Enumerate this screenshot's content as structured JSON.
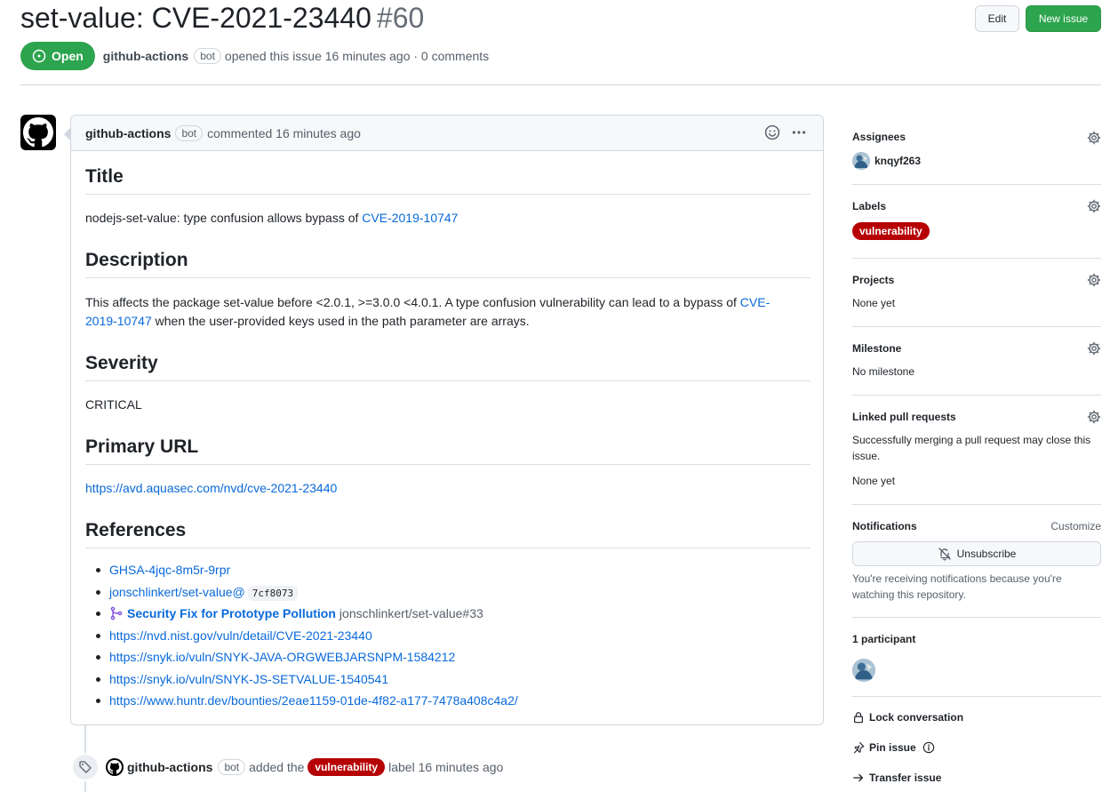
{
  "header": {
    "title": "set-value: CVE-2021-23440",
    "number": "#60",
    "edit_label": "Edit",
    "new_issue_label": "New issue",
    "state": "Open",
    "author": "github-actions",
    "bot": "bot",
    "opened_text": "opened this issue 16 minutes ago · 0 comments"
  },
  "comment": {
    "author": "github-actions",
    "bot": "bot",
    "when": "commented 16 minutes ago",
    "sections": {
      "title_heading": "Title",
      "title_text": "nodejs-set-value: type confusion allows bypass of ",
      "title_link": "CVE-2019-10747",
      "description_heading": "Description",
      "description_text": "This affects the package set-value before <2.0.1, >=3.0.0 <4.0.1. A type confusion vulnerability can lead to a bypass of ",
      "description_link_1": "CVE-",
      "description_link_2": "2019-10747",
      "description_text_2": " when the user-provided keys used in the path parameter are arrays.",
      "severity_heading": "Severity",
      "severity_text": "CRITICAL",
      "primary_url_heading": "Primary URL",
      "primary_url": "https://avd.aquasec.com/nvd/cve-2021-23440",
      "references_heading": "References"
    },
    "references": {
      "ref1": "GHSA-4jqc-8m5r-9rpr",
      "ref2": "jonschlinkert/set-value@",
      "ref2_commit": "7cf8073",
      "ref3_title": "Security Fix for Prototype Pollution",
      "ref3_repo": "jonschlinkert/set-value#33",
      "ref4": "https://nvd.nist.gov/vuln/detail/CVE-2021-23440",
      "ref5": "https://snyk.io/vuln/SNYK-JAVA-ORGWEBJARSNPM-1584212",
      "ref6": "https://snyk.io/vuln/SNYK-JS-SETVALUE-1540541",
      "ref7": "https://www.huntr.dev/bounties/2eae1159-01de-4f82-a177-7478a408c4a2/"
    }
  },
  "timeline": {
    "author": "github-actions",
    "bot": "bot",
    "action": "added the",
    "label": "vulnerability",
    "suffix": "label 16 minutes ago"
  },
  "sidebar": {
    "assignees_heading": "Assignees",
    "assignee": "knqyf263",
    "labels_heading": "Labels",
    "label": "vulnerability",
    "label_color": "#b60205",
    "projects_heading": "Projects",
    "projects_value": "None yet",
    "milestone_heading": "Milestone",
    "milestone_value": "No milestone",
    "linked_heading": "Linked pull requests",
    "linked_desc": "Successfully merging a pull request may close this issue.",
    "linked_value": "None yet",
    "notifications_heading": "Notifications",
    "customize_label": "Customize",
    "unsubscribe_label": "Unsubscribe",
    "notifications_desc": "You're receiving notifications because you're watching this repository.",
    "participants_heading": "1 participant",
    "lock_label": "Lock conversation",
    "pin_label": "Pin issue",
    "transfer_label": "Transfer issue"
  }
}
